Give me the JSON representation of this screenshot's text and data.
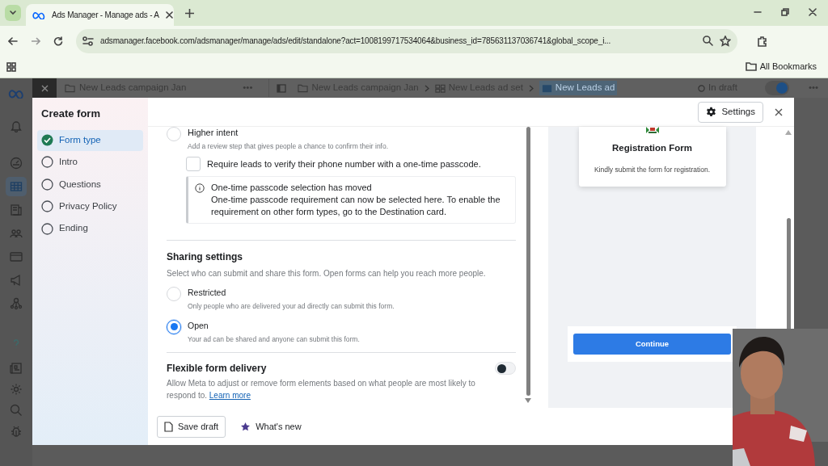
{
  "browser": {
    "tab": {
      "title": "Ads Manager - Manage ads - A"
    },
    "url": "adsmanager.facebook.com/adsmanager/manage/ads/edit/standalone?act=1008199717534064&business_id=785631137036741&global_scope_i...",
    "bookmarks": {
      "all_bookmarks": "All Bookmarks"
    }
  },
  "left_rail": [
    {
      "kind": "bell",
      "selected": false
    },
    {
      "kind": "gauge",
      "selected": false
    },
    {
      "kind": "table",
      "selected": true
    },
    {
      "kind": "pages",
      "selected": false
    },
    {
      "kind": "people",
      "selected": false
    },
    {
      "kind": "card",
      "selected": false
    },
    {
      "kind": "megaphone",
      "selected": false
    },
    {
      "kind": "network",
      "selected": false
    },
    {
      "kind": "help",
      "selected": false
    },
    {
      "kind": "news",
      "selected": false
    },
    {
      "kind": "gear",
      "selected": false
    },
    {
      "kind": "search",
      "selected": false
    },
    {
      "kind": "bug",
      "selected": false
    }
  ],
  "app_bar": {
    "panel_title": "New Leads campaign Jan",
    "more": "•••",
    "breadcrumb": [
      {
        "label": "New Leads campaign Jan",
        "kind": "campaign",
        "selected": false
      },
      {
        "label": "New Leads ad set",
        "kind": "adset",
        "selected": false
      },
      {
        "label": "New Leads ad",
        "kind": "ad",
        "selected": true
      }
    ],
    "status": "In draft",
    "toggle_on": true,
    "end_more": "•••"
  },
  "form_editor": {
    "title": "Create form",
    "steps": [
      {
        "label": "Form type",
        "done": true,
        "selected": true
      },
      {
        "label": "Intro",
        "done": false,
        "selected": false
      },
      {
        "label": "Questions",
        "done": false,
        "selected": false
      },
      {
        "label": "Privacy Policy",
        "done": false,
        "selected": false
      },
      {
        "label": "Ending",
        "done": false,
        "selected": false
      }
    ],
    "settings_button": "Settings",
    "higher_intent": {
      "label": "Higher intent",
      "description": "Add a review step that gives people a chance to confirm their info.",
      "selected": false
    },
    "otp_checkbox": {
      "label": "Require leads to verify their phone number with a one-time passcode.",
      "checked": false
    },
    "notice": {
      "title": "One-time passcode selection has moved",
      "body": "One-time passcode requirement can now be selected here. To enable the requirement on other form types, go to the Destination card."
    },
    "sharing": {
      "heading": "Sharing settings",
      "description": "Select who can submit and share this form. Open forms can help you reach more people.",
      "options": [
        {
          "label": "Restricted",
          "description": "Only people who are delivered your ad directly can submit this form.",
          "selected": false
        },
        {
          "label": "Open",
          "description": "Your ad can be shared and anyone can submit this form.",
          "selected": true
        }
      ]
    },
    "flexible_delivery": {
      "heading": "Flexible form delivery",
      "description": "Allow Meta to adjust or remove form elements based on what people are most likely to respond to.",
      "link": "Learn more",
      "on": false
    },
    "footer": {
      "save_draft": "Save draft",
      "whats_new": "What's new"
    },
    "preview": {
      "title": "Registration Form",
      "description": "Kindly submit the form for registration.",
      "button": "Continue"
    }
  }
}
